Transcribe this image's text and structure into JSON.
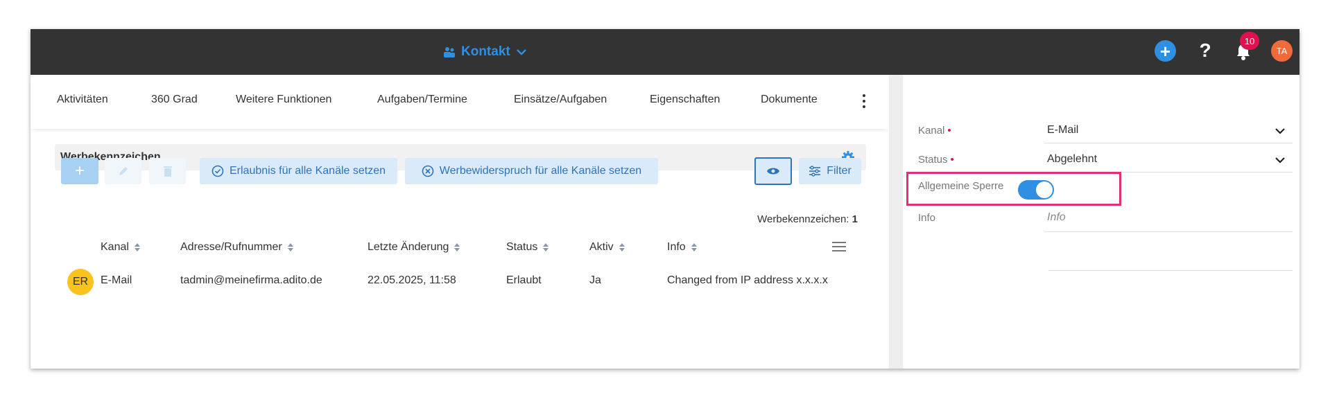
{
  "header": {
    "title": "Kontakt",
    "notification_count": "10",
    "user_initials": "TA",
    "help_label": "?"
  },
  "tabs": [
    {
      "label": "Aktivitäten"
    },
    {
      "label": "360 Grad"
    },
    {
      "label": "Weitere Funktionen"
    },
    {
      "label": "Aufgaben/Termine"
    },
    {
      "label": "Einsätze/Aufgaben"
    },
    {
      "label": "Eigenschaften"
    },
    {
      "label": "Dokumente"
    }
  ],
  "section": {
    "title": "Werbekennzeichen",
    "count_label": "Werbekennzeichen:",
    "count_value": "1"
  },
  "toolbar": {
    "add_label": "+",
    "allow_all_label": "Erlaubnis für alle Kanäle setzen",
    "object_all_label": "Werbewiderspruch für alle Kanäle setzen",
    "filter_label": "Filter"
  },
  "table": {
    "columns": [
      "Kanal",
      "Adresse/Rufnummer",
      "Letzte Änderung",
      "Status",
      "Aktiv",
      "Info"
    ],
    "rows": [
      {
        "avatar": "ER",
        "kanal": "E-Mail",
        "adresse": "tadmin@meinefirma.adito.de",
        "letzte_aenderung": "22.05.2025, 11:58",
        "status": "Erlaubt",
        "aktiv": "Ja",
        "info": "Changed from IP address x.x.x.x"
      }
    ]
  },
  "form": {
    "kanal_label": "Kanal",
    "kanal_value": "E-Mail",
    "status_label": "Status",
    "status_value": "Abgelehnt",
    "sperre_label": "Allgemeine Sperre",
    "sperre_on": true,
    "info_label": "Info",
    "info_placeholder": "Info",
    "required_marker": "•"
  },
  "colors": {
    "topbar": "#333333",
    "accent": "#2f8fe0",
    "badge": "#e0114f",
    "highlight": "#e0307a",
    "avatar_row": "#f7c31c",
    "avatar_user": "#f06a3a"
  }
}
